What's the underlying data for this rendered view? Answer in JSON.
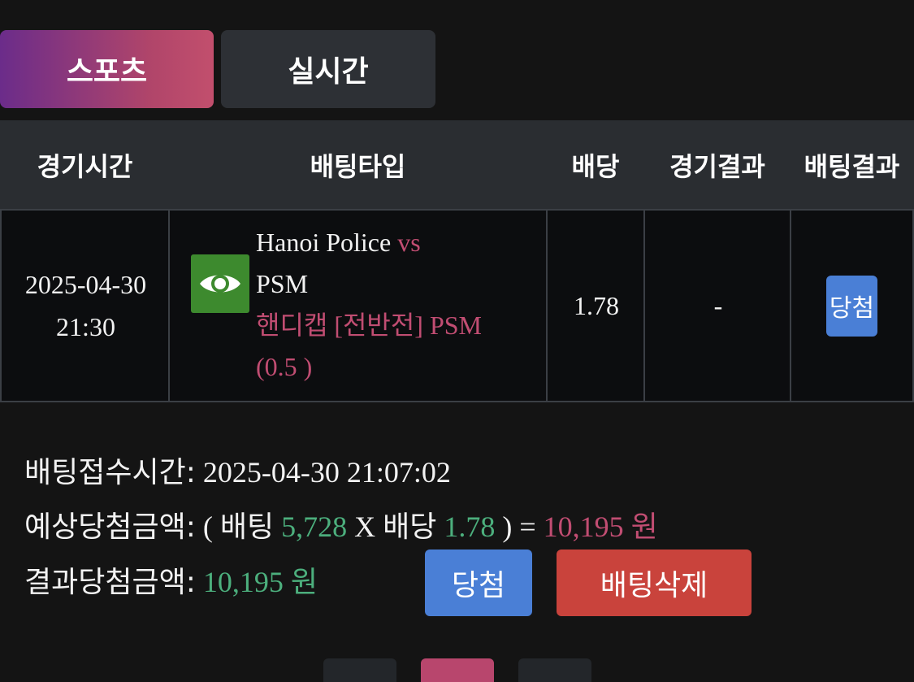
{
  "tabs": [
    {
      "label": "스포츠",
      "active": true
    },
    {
      "label": "실시간",
      "active": false
    }
  ],
  "table": {
    "headers": [
      "경기시간",
      "배팅타입",
      "배당",
      "경기결과",
      "배팅결과"
    ],
    "row": {
      "date": "2025-04-30",
      "time": "21:30",
      "home_team": "Hanoi Police",
      "vs": "vs",
      "away_team": "PSM",
      "bet_type": "핸디캡 [전반전] PSM",
      "bet_line": "(0.5 )",
      "odds": "1.78",
      "match_result": "-",
      "bet_result": "당첨"
    }
  },
  "summary": {
    "received_label": "배팅접수시간:",
    "received_value": "2025-04-30 21:07:02",
    "expected_label": "예상당첨금액:",
    "expected_open": "( 배팅",
    "expected_bet": "5,728",
    "expected_x": "X 배당",
    "expected_odds": "1.78",
    "expected_close": ") =",
    "expected_amount": "10,195 원",
    "result_label": "결과당첨금액:",
    "result_amount": "10,195 원"
  },
  "buttons": {
    "win": "당첨",
    "delete": "배팅삭제"
  },
  "colors": {
    "accent_pink": "#c14d72",
    "accent_green": "#4caf7d",
    "win_blue": "#4a7fd6",
    "delete_red": "#c9433c"
  },
  "icons": {
    "match_icon": "eye-icon"
  }
}
